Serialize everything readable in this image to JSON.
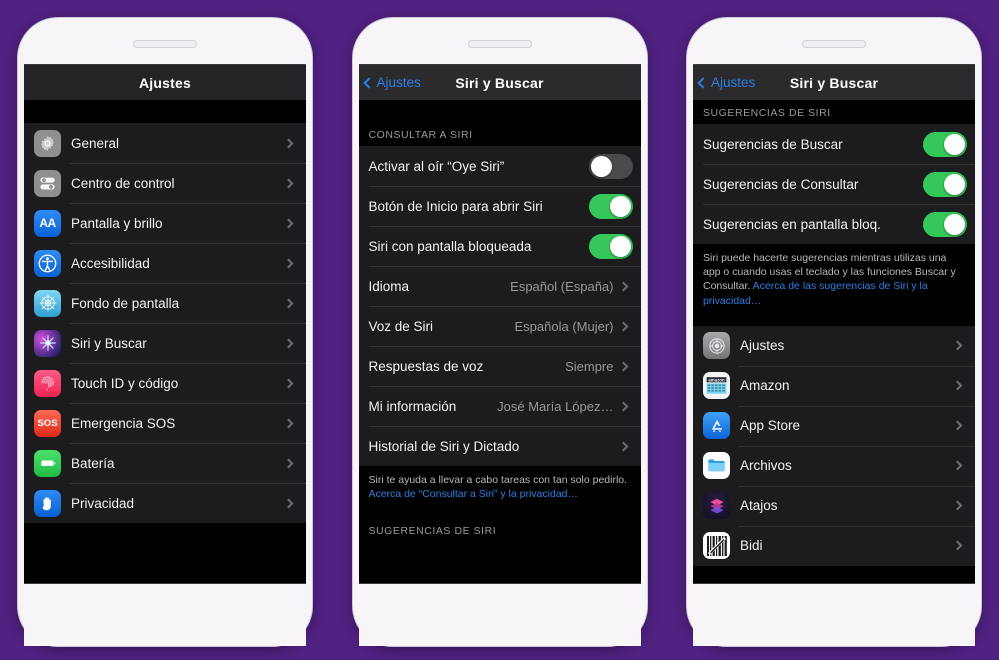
{
  "theme": {
    "background": "#4f2180",
    "phone_body": "#f7f5f8",
    "screen_bg": "#000000",
    "row_bg": "#1c1c1e",
    "accent_blue": "#2f7fe6",
    "toggle_on": "#35c759",
    "toggle_off": "#4a4a4e",
    "label_color": "#f2f2f4",
    "secondary_text": "#98989d"
  },
  "phones": [
    {
      "id": "phone-settings-root",
      "navbar": {
        "title": "Ajustes",
        "back_label": null
      },
      "sections": [
        {
          "header": null,
          "rows": [
            {
              "label": "General",
              "icon": "gear-icon",
              "icon_bg": "#8e8e93",
              "accessory": "chevron"
            },
            {
              "label": "Centro de control",
              "icon": "control-center-icon",
              "icon_bg": "#8e8e93",
              "accessory": "chevron"
            },
            {
              "label": "Pantalla y brillo",
              "icon": "display-aa-icon",
              "icon_bg": "#1675ea",
              "accessory": "chevron"
            },
            {
              "label": "Accesibilidad",
              "icon": "accessibility-icon",
              "icon_bg": "#1675ea",
              "accessory": "chevron"
            },
            {
              "label": "Fondo de pantalla",
              "icon": "wallpaper-icon",
              "icon_bg": "#4db6e8",
              "accessory": "chevron"
            },
            {
              "label": "Siri y Buscar",
              "icon": "siri-icon",
              "icon_bg": "#2b1f47",
              "accessory": "chevron"
            },
            {
              "label": "Touch ID y código",
              "icon": "touch-id-icon",
              "icon_bg": "#f4356b",
              "accessory": "chevron"
            },
            {
              "label": "Emergencia SOS",
              "icon": "sos-icon",
              "icon_bg": "#e8453c",
              "accessory": "chevron"
            },
            {
              "label": "Batería",
              "icon": "battery-icon",
              "icon_bg": "#34c759",
              "accessory": "chevron"
            },
            {
              "label": "Privacidad",
              "icon": "privacy-hand-icon",
              "icon_bg": "#1675ea",
              "accessory": "chevron"
            }
          ]
        }
      ]
    },
    {
      "id": "phone-siri-search",
      "navbar": {
        "title": "Siri y Buscar",
        "back_label": "Ajustes"
      },
      "sections": [
        {
          "header": "CONSULTAR A SIRI",
          "rows": [
            {
              "label": "Activar al oír “Oye Siri”",
              "accessory": "toggle",
              "toggle_on": false
            },
            {
              "label": "Botón de Inicio para abrir Siri",
              "accessory": "toggle",
              "toggle_on": true
            },
            {
              "label": "Siri con pantalla bloqueada",
              "accessory": "toggle",
              "toggle_on": true
            },
            {
              "label": "Idioma",
              "value": "Español (España)",
              "accessory": "chevron"
            },
            {
              "label": "Voz de Siri",
              "value": "Española (Mujer)",
              "accessory": "chevron"
            },
            {
              "label": "Respuestas de voz",
              "value": "Siempre",
              "accessory": "chevron"
            },
            {
              "label": "Mi información",
              "value": "José María López…",
              "accessory": "chevron"
            },
            {
              "label": "Historial de Siri y Dictado",
              "accessory": "chevron"
            }
          ],
          "note": {
            "text": "Siri te ayuda a llevar a cabo tareas con tan solo pedirlo. ",
            "link": "Acerca de “Consultar a Siri” y la privacidad…"
          }
        },
        {
          "header": "SUGERENCIAS DE SIRI",
          "rows": []
        }
      ]
    },
    {
      "id": "phone-siri-suggestions",
      "navbar": {
        "title": "Siri y Buscar",
        "back_label": "Ajustes"
      },
      "sections": [
        {
          "header": "SUGERENCIAS DE SIRI",
          "rows": [
            {
              "label": "Sugerencias de Buscar",
              "accessory": "toggle",
              "toggle_on": true
            },
            {
              "label": "Sugerencias de Consultar",
              "accessory": "toggle",
              "toggle_on": true
            },
            {
              "label": "Sugerencias en pantalla bloq.",
              "accessory": "toggle",
              "toggle_on": true
            }
          ],
          "note": {
            "text": "Siri puede hacerte sugerencias mientras utilizas una app o cuando usas el teclado y las funciones Buscar y Consultar. ",
            "link": "Acerca de las sugerencias de Siri y la privacidad…"
          }
        },
        {
          "header": null,
          "rows": [
            {
              "label": "Ajustes",
              "icon": "settings-app-icon",
              "icon_bg": "#8e8e93",
              "accessory": "chevron"
            },
            {
              "label": "Amazon",
              "icon": "amazon-app-icon",
              "icon_bg": "#f2f2f4",
              "accessory": "chevron"
            },
            {
              "label": "App Store",
              "icon": "app-store-icon",
              "icon_bg": "#1675ea",
              "accessory": "chevron"
            },
            {
              "label": "Archivos",
              "icon": "files-app-icon",
              "icon_bg": "#ffffff",
              "accessory": "chevron"
            },
            {
              "label": "Atajos",
              "icon": "shortcuts-app-icon",
              "icon_bg": "#18122b",
              "accessory": "chevron"
            },
            {
              "label": "Bidi",
              "icon": "bidi-app-icon",
              "icon_bg": "#1c1c1e",
              "accessory": "chevron"
            }
          ]
        }
      ]
    }
  ]
}
